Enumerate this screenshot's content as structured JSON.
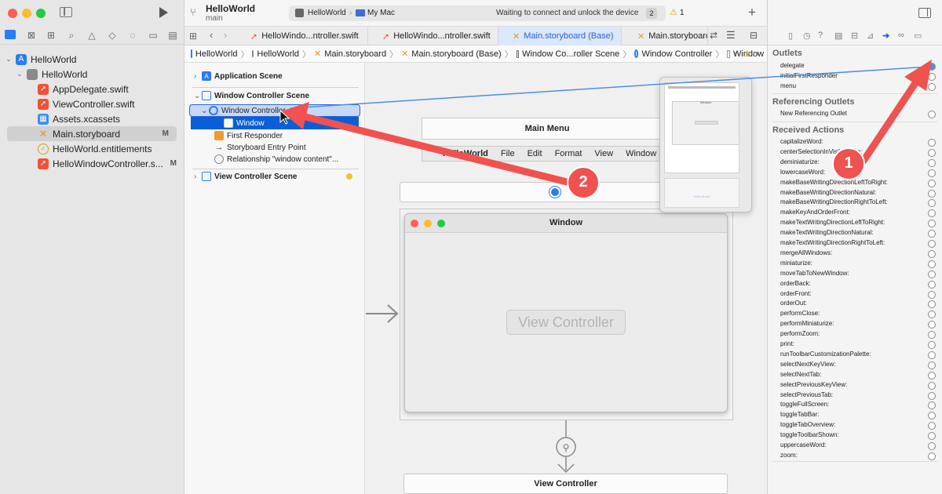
{
  "toolbar": {
    "project": "HelloWorld",
    "branch": "main",
    "scheme": "HelloWorld",
    "destination": "My Mac",
    "status": "Waiting to connect and unlock the device",
    "status_count": "2",
    "warning_count": "1"
  },
  "navigator": {
    "items": [
      {
        "label": "HelloWorld",
        "badge": ""
      },
      {
        "label": "HelloWorld",
        "badge": ""
      },
      {
        "label": "AppDelegate.swift",
        "badge": ""
      },
      {
        "label": "ViewController.swift",
        "badge": ""
      },
      {
        "label": "Assets.xcassets",
        "badge": ""
      },
      {
        "label": "Main.storyboard",
        "badge": "M"
      },
      {
        "label": "HelloWorld.entitlements",
        "badge": ""
      },
      {
        "label": "HelloWindowController.s...",
        "badge": "M"
      }
    ]
  },
  "tabs": [
    {
      "label": "HelloWindo...ntroller.swift"
    },
    {
      "label": "HelloWindo...ntroller.swift"
    },
    {
      "label": "Main.storyboard (Base)"
    },
    {
      "label": "Main.storyboard"
    }
  ],
  "jumpbar": [
    "HelloWorld",
    "HelloWorld",
    "Main.storyboard",
    "Main.storyboard (Base)",
    "Window Co...roller Scene",
    "Window Controller",
    "Window"
  ],
  "outline": {
    "application_scene": "Application Scene",
    "window_controller_scene": "Window Controller Scene",
    "window_controller": "Window Controller",
    "window": "Window",
    "first_responder": "First Responder",
    "storyboard_entry_point": "Storyboard Entry Point",
    "relationship": "Relationship \"window content\"...",
    "view_controller_scene": "View Controller Scene"
  },
  "canvas": {
    "main_menu_title": "Main Menu",
    "menu_items": [
      "HelloWorld",
      "File",
      "Edit",
      "Format",
      "View",
      "Window"
    ],
    "window_title": "Window",
    "view_controller_placeholder": "View Controller",
    "view_controller_scene_title": "View Controller",
    "thumbnail_window_title": "Window",
    "thumbnail_vc_label": "Hello World"
  },
  "inspector": {
    "outlets_header": "Outlets",
    "outlets": [
      "delegate",
      "initialFirstResponder",
      "menu"
    ],
    "referencing_header": "Referencing Outlets",
    "referencing": [
      "New Referencing Outlet"
    ],
    "received_header": "Received Actions",
    "actions": [
      "capitalizeWord:",
      "centerSelectionInVisibleArea:",
      "deminiaturize:",
      "lowercaseWord:",
      "makeBaseWritingDirectionLeftToRight:",
      "makeBaseWritingDirectionNatural:",
      "makeBaseWritingDirectionRightToLeft:",
      "makeKeyAndOrderFront:",
      "makeTextWritingDirectionLeftToRight:",
      "makeTextWritingDirectionNatural:",
      "makeTextWritingDirectionRightToLeft:",
      "mergeAllWindows:",
      "miniaturize:",
      "moveTabToNewWindow:",
      "orderBack:",
      "orderFront:",
      "orderOut:",
      "performClose:",
      "performMiniaturize:",
      "performZoom:",
      "print:",
      "runToolbarCustomizationPalette:",
      "selectNextKeyView:",
      "selectNextTab:",
      "selectPreviousKeyView:",
      "selectPreviousTab:",
      "toggleFullScreen:",
      "toggleTabBar:",
      "toggleTabOverview:",
      "toggleToolbarShown:",
      "uppercaseWord:",
      "zoom:"
    ]
  },
  "annotations": {
    "step1": "1",
    "step2": "2"
  },
  "colors": {
    "accent": "#2a64d4",
    "selection": "#0a5fd6",
    "annotation": "#f0524f"
  }
}
